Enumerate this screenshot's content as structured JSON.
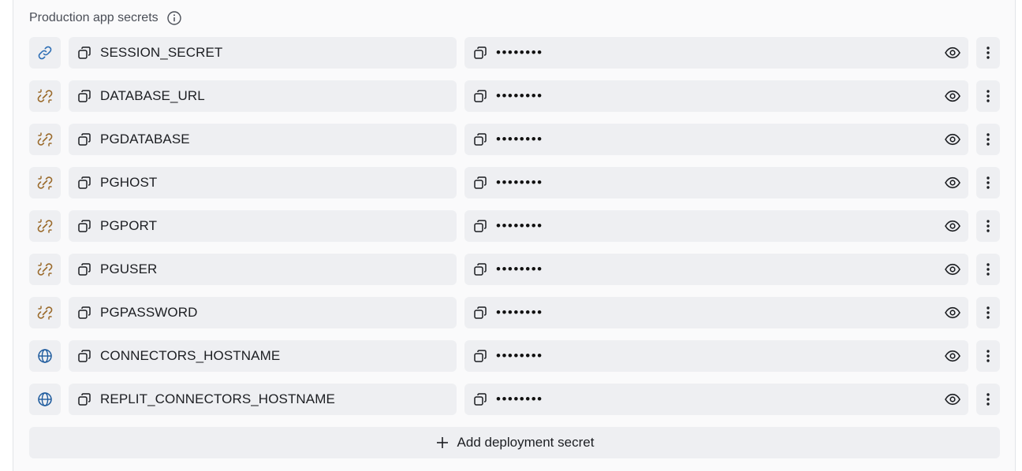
{
  "section": {
    "title": "Production app secrets",
    "info_icon": "info-icon"
  },
  "colors": {
    "link": "#2f6fb5",
    "broken_link": "#9a6a2b",
    "globe": "#1f5c9e"
  },
  "secrets": [
    {
      "key": "SESSION_SECRET",
      "value": "••••••••",
      "type_icon": "link-icon"
    },
    {
      "key": "DATABASE_URL",
      "value": "••••••••",
      "type_icon": "unlink-icon"
    },
    {
      "key": "PGDATABASE",
      "value": "••••••••",
      "type_icon": "unlink-icon"
    },
    {
      "key": "PGHOST",
      "value": "••••••••",
      "type_icon": "unlink-icon"
    },
    {
      "key": "PGPORT",
      "value": "••••••••",
      "type_icon": "unlink-icon"
    },
    {
      "key": "PGUSER",
      "value": "••••••••",
      "type_icon": "unlink-icon"
    },
    {
      "key": "PGPASSWORD",
      "value": "••••••••",
      "type_icon": "unlink-icon"
    },
    {
      "key": "CONNECTORS_HOSTNAME",
      "value": "••••••••",
      "type_icon": "globe-icon"
    },
    {
      "key": "REPLIT_CONNECTORS_HOSTNAME",
      "value": "••••••••",
      "type_icon": "globe-icon"
    }
  ],
  "add_button": {
    "label": "Add deployment secret"
  }
}
